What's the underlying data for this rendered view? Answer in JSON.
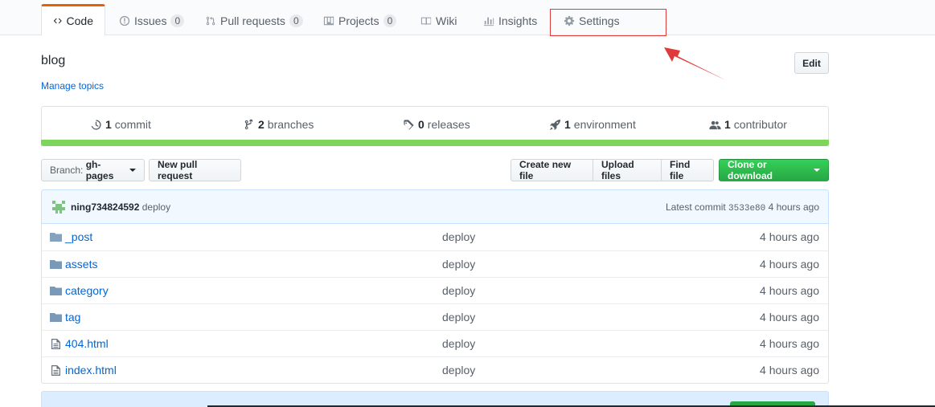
{
  "tabs": [
    {
      "label": "Code",
      "icon": "code-icon",
      "selected": true
    },
    {
      "label": "Issues",
      "icon": "issue-icon",
      "count": "0"
    },
    {
      "label": "Pull requests",
      "icon": "pull-request-icon",
      "count": "0"
    },
    {
      "label": "Projects",
      "icon": "project-icon",
      "count": "0"
    },
    {
      "label": "Wiki",
      "icon": "book-icon"
    },
    {
      "label": "Insights",
      "icon": "graph-icon"
    },
    {
      "label": "Settings",
      "icon": "gear-icon"
    }
  ],
  "repo": {
    "description": "blog",
    "manage_topics": "Manage topics",
    "edit_label": "Edit"
  },
  "summary": {
    "commits": {
      "count": "1",
      "label": "commit"
    },
    "branches": {
      "count": "2",
      "label": "branches"
    },
    "releases": {
      "count": "0",
      "label": "releases"
    },
    "environments": {
      "count": "1",
      "label": "environment"
    },
    "contributors": {
      "count": "1",
      "label": "contributor"
    }
  },
  "file_nav": {
    "branch_prefix": "Branch:",
    "branch": "gh-pages",
    "new_pull_request": "New pull request",
    "create_new_file": "Create new file",
    "upload_files": "Upload files",
    "find_file": "Find file",
    "clone_or_download": "Clone or download"
  },
  "commit": {
    "author": "ning734824592",
    "message": "deploy",
    "latest_prefix": "Latest commit",
    "sha": "3533e80",
    "age": "4 hours ago"
  },
  "files": [
    {
      "name": "_post",
      "type": "folder",
      "message": "deploy",
      "age": "4 hours ago"
    },
    {
      "name": "assets",
      "type": "folder",
      "message": "deploy",
      "age": "4 hours ago"
    },
    {
      "name": "category",
      "type": "folder",
      "message": "deploy",
      "age": "4 hours ago"
    },
    {
      "name": "tag",
      "type": "folder",
      "message": "deploy",
      "age": "4 hours ago"
    },
    {
      "name": "404.html",
      "type": "file",
      "message": "deploy",
      "age": "4 hours ago"
    },
    {
      "name": "index.html",
      "type": "file",
      "message": "deploy",
      "age": "4 hours ago"
    }
  ],
  "colors": {
    "accent_orange": "#e36209",
    "link": "#0366d6",
    "language_bar": "#7ed55c",
    "green_button": "#28a745",
    "annotation_red": "#e03b3b"
  }
}
